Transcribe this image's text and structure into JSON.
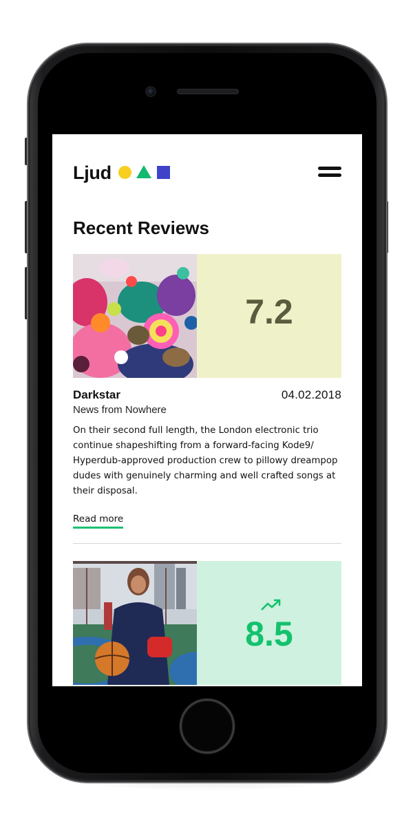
{
  "app": {
    "brand": "Ljud",
    "colors": {
      "brand_yellow": "#f7cf1f",
      "brand_green": "#12b96f",
      "brand_blue": "#3f43c9",
      "score_low_bg": "#eff2c9",
      "score_high_bg": "#cef2df",
      "score_high_text": "#14c16d",
      "link_underline": "#1dbf73"
    },
    "menu_icon": "hamburger-icon"
  },
  "section": {
    "title": "Recent Reviews"
  },
  "reviews": [
    {
      "artist": "Darkstar",
      "album": "News from Nowhere",
      "date": "04.02.2018",
      "score": "7.2",
      "trend_icon": null,
      "description": "On their second full length, the London electronic trio continue shapeshifting from a forward-facing Kode9/ Hyperdub-approved production crew to pillowy dreampop dudes with genuinely charming and well crafted songs at their disposal.",
      "read_more": "Read more"
    },
    {
      "score": "8.5",
      "trend_icon": "trending-up-icon"
    }
  ]
}
